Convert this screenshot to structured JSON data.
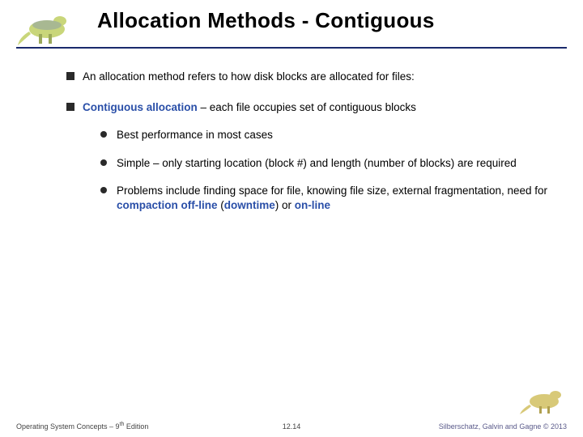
{
  "slide": {
    "title": "Allocation Methods - Contiguous",
    "bullets": {
      "b1": "An allocation method refers to how disk blocks are allocated for files:",
      "b2_term": "Contiguous allocation",
      "b2_rest": " – each file occupies set of contiguous blocks",
      "s1": "Best performance in most cases",
      "s2": "Simple – only starting location (block #) and length (number of blocks) are required",
      "s3_a": "Problems include finding space for file, knowing file size, external fragmentation, need for ",
      "s3_t1": "compaction off-line",
      "s3_b": " (",
      "s3_t2": "downtime",
      "s3_c": ") or ",
      "s3_t3": "on-line"
    }
  },
  "footer": {
    "left_a": "Operating System Concepts – 9",
    "left_sup": "th",
    "left_b": " Edition",
    "center": "12.14",
    "right": "Silberschatz, Galvin and Gagne © 2013"
  }
}
